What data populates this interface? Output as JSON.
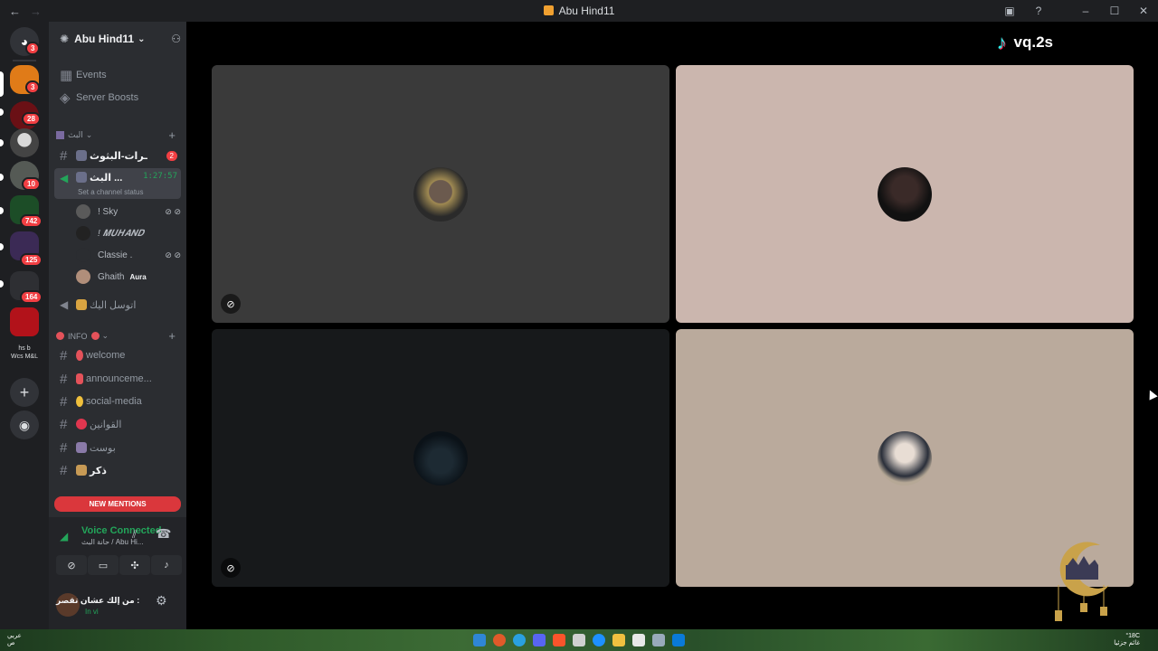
{
  "window": {
    "title": "Abu Hind11"
  },
  "servers": {
    "badges": [
      "3",
      "3",
      "28",
      "10",
      "742",
      "125",
      "164"
    ],
    "folder_label_top": "hs  b",
    "folder_label_bottom": "Wcs M&L"
  },
  "guild": {
    "name": "Abu Hind11"
  },
  "sidebar": {
    "events": "Events",
    "boosts": "Server Boosts",
    "category1": "البث",
    "ch_broadcast_notes": "ـرات-البثوث",
    "ch_broadcast_notes_badge": "2",
    "voice_channel": "البث ...",
    "voice_timer": "1:27:57",
    "channel_status": "Set a channel status",
    "users": [
      "! Sky",
      "! 𝑴𝑼𝑯𝑨𝑵𝑫",
      "Classie .",
      "Ghaith"
    ],
    "user_tag_ghaith": "Aura",
    "ch_pray": "اتوسل اليك",
    "category2": "INFO",
    "channels": [
      "welcome",
      "announceme...",
      "social-media",
      "القوانين",
      "بوست",
      "ذكر"
    ],
    "new_mentions": "NEW MENTIONS"
  },
  "voice": {
    "status": "Voice Connected",
    "location": "حانة البث / Abu Hi..."
  },
  "account": {
    "name": "من إلك عشان تقصر :",
    "status": "In vi"
  },
  "stage": {
    "watermark": "vq.2s",
    "tiles": [
      {
        "bg": "#3a3a3a",
        "muted_video": true
      },
      {
        "bg": "#cbb6ae",
        "muted_video": false
      },
      {
        "bg": "#17191b",
        "muted_video": true
      },
      {
        "bg": "#baaa9c",
        "muted_video": false
      }
    ]
  },
  "taskbar": {
    "left_text_1": "عربي",
    "left_text_2": "ص",
    "right_text_1": "°18C",
    "right_text_2": "غائم جزئيا"
  },
  "colors": {
    "accent_red": "#da373c",
    "voice_green": "#23a55a"
  }
}
